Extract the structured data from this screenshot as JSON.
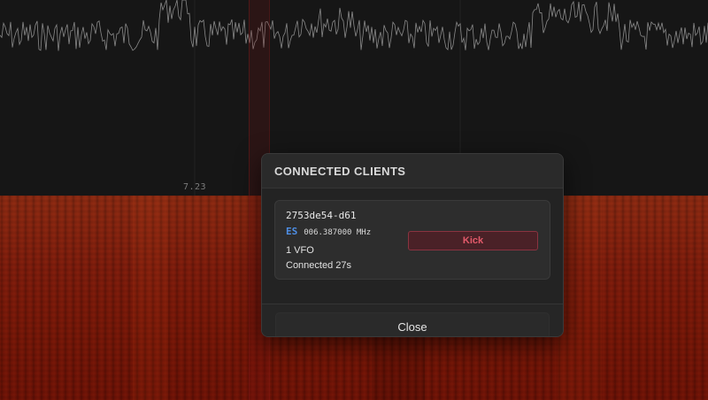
{
  "spectrum": {
    "freq_tick_label": "7.23"
  },
  "clients_modal": {
    "title": "CONNECTED CLIENTS",
    "clients": [
      {
        "id": "2753de54-d61",
        "mode": "ES",
        "frequency": "006.387000 MHz",
        "vfo_count": "1 VFO",
        "connected": "Connected 27s",
        "kick_label": "Kick"
      }
    ],
    "close_label": "Close"
  },
  "colors": {
    "background": "#141414",
    "modal_bg": "#262626",
    "mode_accent": "#4e8fe6",
    "kick_text": "#e35a6a",
    "kick_bg": "#4a2127",
    "waterfall": "#7e1c0c",
    "spectrum_trace": "#8a8a8a"
  }
}
